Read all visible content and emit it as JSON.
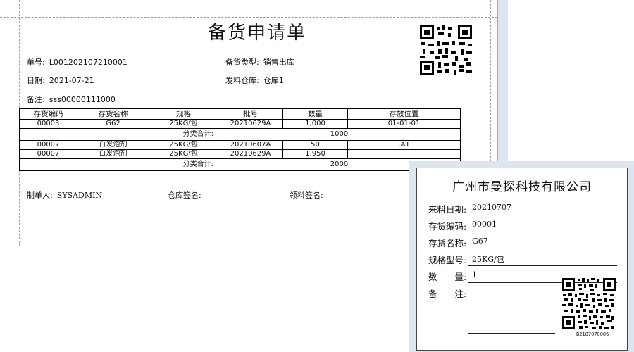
{
  "document": {
    "title": "备货申请单",
    "order_no_label": "单号:",
    "order_no": "L001202107210001",
    "type_label": "备货类型:",
    "type_value": "销售出库",
    "date_label": "日期:",
    "date_value": "2021-07-21",
    "warehouse_label": "发料仓库:",
    "warehouse_value": "仓库1",
    "remark_label": "备注:",
    "remark_value": "sss00000111000"
  },
  "table": {
    "headers": [
      "存货编码",
      "存货名称",
      "规格",
      "批号",
      "数量",
      "存放位置"
    ],
    "group1_rows": [
      [
        "00003",
        "G62",
        "25KG/包",
        "20210629A",
        "1,000",
        "01-01-01"
      ]
    ],
    "group1_total_label": "分类合计:",
    "group1_total_value": "1000",
    "group2_rows": [
      [
        "00007",
        "白发泡剂",
        "25KG/包",
        "20210607A",
        "50",
        ",A1"
      ],
      [
        "00007",
        "白发泡剂",
        "25KG/包",
        "20210629A",
        "1,950",
        ""
      ]
    ],
    "group2_total_label": "分类合计:",
    "group2_total_value": "2000"
  },
  "footer": {
    "maker_label": "制单人:",
    "maker_value": "SYSADMIN",
    "warehouse_sign_label": "仓库签名:",
    "receiver_sign_label": "领料签名:"
  },
  "label_card": {
    "company": "广州市曼探科技有限公司",
    "incoming_date_label": "来料日期:",
    "incoming_date_value": "20210707",
    "code_label": "存货编码:",
    "code_value": "00001",
    "name_label": "存货名称:",
    "name_value": "G67",
    "spec_label": "规格型号:",
    "spec_value": "25KG/包",
    "qty_label": "数　　量:",
    "qty_value": "1",
    "note_label": "备　　注:",
    "barcode_text": "B2107070006"
  }
}
